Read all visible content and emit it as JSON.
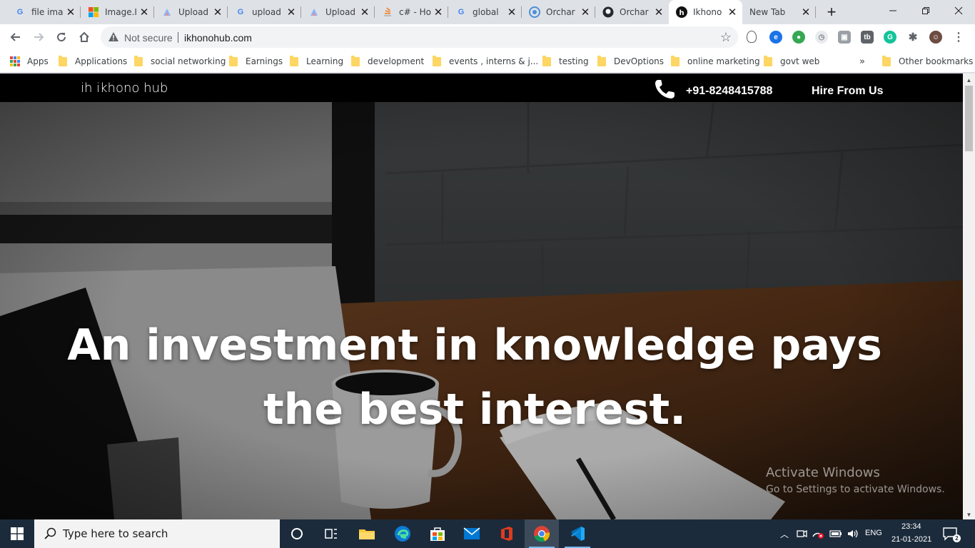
{
  "browser": {
    "tabs": [
      {
        "title": "file ima",
        "favicon": "google-icon"
      },
      {
        "title": "Image.I",
        "favicon": "microsoft-icon"
      },
      {
        "title": "Upload",
        "favicon": "upload-icon"
      },
      {
        "title": "upload",
        "favicon": "google-icon"
      },
      {
        "title": "Upload",
        "favicon": "upload-icon"
      },
      {
        "title": "c# - Ho",
        "favicon": "stackoverflow-icon"
      },
      {
        "title": "global",
        "favicon": "google-icon"
      },
      {
        "title": "Orchar",
        "favicon": "orchard-icon"
      },
      {
        "title": "Orchar",
        "favicon": "github-icon"
      },
      {
        "title": "Ikhono",
        "favicon": "ikhono-icon",
        "active": true
      },
      {
        "title": "New Tab",
        "favicon": "none"
      }
    ],
    "address": {
      "security_label": "Not secure",
      "url": "ikhonohub.com"
    },
    "bookmarks": [
      {
        "label": "Apps",
        "icon": "apps-grid-icon"
      },
      {
        "label": "Applications",
        "icon": "folder-icon"
      },
      {
        "label": "social networking",
        "icon": "folder-icon"
      },
      {
        "label": "Earnings",
        "icon": "folder-icon"
      },
      {
        "label": "Learning",
        "icon": "folder-icon"
      },
      {
        "label": "development",
        "icon": "folder-icon"
      },
      {
        "label": "events , interns & j...",
        "icon": "folder-icon"
      },
      {
        "label": "testing",
        "icon": "folder-icon"
      },
      {
        "label": "DevOptions",
        "icon": "folder-icon"
      },
      {
        "label": "online marketing",
        "icon": "folder-icon"
      },
      {
        "label": "govt web",
        "icon": "folder-icon"
      },
      {
        "label": "»",
        "icon": "chevron-double-right-icon"
      },
      {
        "label": "Other bookmarks",
        "icon": "folder-icon"
      }
    ]
  },
  "site": {
    "logo": "ih ikhono hub",
    "phone": "+91-8248415788",
    "hire_link": "Hire From Us",
    "headline_line1": "An investment in knowledge pays",
    "headline_line2": "the best interest."
  },
  "watermark": {
    "title": "Activate Windows",
    "subtitle": "Go to Settings to activate Windows."
  },
  "taskbar": {
    "search_placeholder": "Type here to search",
    "language": "ENG",
    "time": "23:34",
    "date": "21-01-2021",
    "notification_count": "2"
  },
  "colors": {
    "site_header": "#000000",
    "taskbar": "#1c2b3c",
    "tabstrip": "#dee1e6",
    "folder": "#fdd663"
  }
}
